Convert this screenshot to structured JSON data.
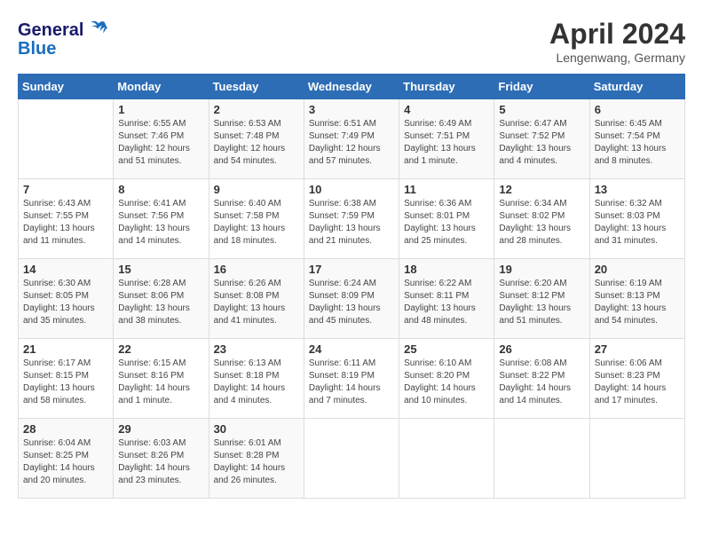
{
  "header": {
    "logo_general": "General",
    "logo_blue": "Blue",
    "month_year": "April 2024",
    "location": "Lengenwang, Germany"
  },
  "days_of_week": [
    "Sunday",
    "Monday",
    "Tuesday",
    "Wednesday",
    "Thursday",
    "Friday",
    "Saturday"
  ],
  "weeks": [
    [
      {
        "day": "",
        "sunrise": "",
        "sunset": "",
        "daylight": ""
      },
      {
        "day": "1",
        "sunrise": "6:55 AM",
        "sunset": "7:46 PM",
        "daylight": "12 hours and 51 minutes."
      },
      {
        "day": "2",
        "sunrise": "6:53 AM",
        "sunset": "7:48 PM",
        "daylight": "12 hours and 54 minutes."
      },
      {
        "day": "3",
        "sunrise": "6:51 AM",
        "sunset": "7:49 PM",
        "daylight": "12 hours and 57 minutes."
      },
      {
        "day": "4",
        "sunrise": "6:49 AM",
        "sunset": "7:51 PM",
        "daylight": "13 hours and 1 minute."
      },
      {
        "day": "5",
        "sunrise": "6:47 AM",
        "sunset": "7:52 PM",
        "daylight": "13 hours and 4 minutes."
      },
      {
        "day": "6",
        "sunrise": "6:45 AM",
        "sunset": "7:54 PM",
        "daylight": "13 hours and 8 minutes."
      }
    ],
    [
      {
        "day": "7",
        "sunrise": "6:43 AM",
        "sunset": "7:55 PM",
        "daylight": "13 hours and 11 minutes."
      },
      {
        "day": "8",
        "sunrise": "6:41 AM",
        "sunset": "7:56 PM",
        "daylight": "13 hours and 14 minutes."
      },
      {
        "day": "9",
        "sunrise": "6:40 AM",
        "sunset": "7:58 PM",
        "daylight": "13 hours and 18 minutes."
      },
      {
        "day": "10",
        "sunrise": "6:38 AM",
        "sunset": "7:59 PM",
        "daylight": "13 hours and 21 minutes."
      },
      {
        "day": "11",
        "sunrise": "6:36 AM",
        "sunset": "8:01 PM",
        "daylight": "13 hours and 25 minutes."
      },
      {
        "day": "12",
        "sunrise": "6:34 AM",
        "sunset": "8:02 PM",
        "daylight": "13 hours and 28 minutes."
      },
      {
        "day": "13",
        "sunrise": "6:32 AM",
        "sunset": "8:03 PM",
        "daylight": "13 hours and 31 minutes."
      }
    ],
    [
      {
        "day": "14",
        "sunrise": "6:30 AM",
        "sunset": "8:05 PM",
        "daylight": "13 hours and 35 minutes."
      },
      {
        "day": "15",
        "sunrise": "6:28 AM",
        "sunset": "8:06 PM",
        "daylight": "13 hours and 38 minutes."
      },
      {
        "day": "16",
        "sunrise": "6:26 AM",
        "sunset": "8:08 PM",
        "daylight": "13 hours and 41 minutes."
      },
      {
        "day": "17",
        "sunrise": "6:24 AM",
        "sunset": "8:09 PM",
        "daylight": "13 hours and 45 minutes."
      },
      {
        "day": "18",
        "sunrise": "6:22 AM",
        "sunset": "8:11 PM",
        "daylight": "13 hours and 48 minutes."
      },
      {
        "day": "19",
        "sunrise": "6:20 AM",
        "sunset": "8:12 PM",
        "daylight": "13 hours and 51 minutes."
      },
      {
        "day": "20",
        "sunrise": "6:19 AM",
        "sunset": "8:13 PM",
        "daylight": "13 hours and 54 minutes."
      }
    ],
    [
      {
        "day": "21",
        "sunrise": "6:17 AM",
        "sunset": "8:15 PM",
        "daylight": "13 hours and 58 minutes."
      },
      {
        "day": "22",
        "sunrise": "6:15 AM",
        "sunset": "8:16 PM",
        "daylight": "14 hours and 1 minute."
      },
      {
        "day": "23",
        "sunrise": "6:13 AM",
        "sunset": "8:18 PM",
        "daylight": "14 hours and 4 minutes."
      },
      {
        "day": "24",
        "sunrise": "6:11 AM",
        "sunset": "8:19 PM",
        "daylight": "14 hours and 7 minutes."
      },
      {
        "day": "25",
        "sunrise": "6:10 AM",
        "sunset": "8:20 PM",
        "daylight": "14 hours and 10 minutes."
      },
      {
        "day": "26",
        "sunrise": "6:08 AM",
        "sunset": "8:22 PM",
        "daylight": "14 hours and 14 minutes."
      },
      {
        "day": "27",
        "sunrise": "6:06 AM",
        "sunset": "8:23 PM",
        "daylight": "14 hours and 17 minutes."
      }
    ],
    [
      {
        "day": "28",
        "sunrise": "6:04 AM",
        "sunset": "8:25 PM",
        "daylight": "14 hours and 20 minutes."
      },
      {
        "day": "29",
        "sunrise": "6:03 AM",
        "sunset": "8:26 PM",
        "daylight": "14 hours and 23 minutes."
      },
      {
        "day": "30",
        "sunrise": "6:01 AM",
        "sunset": "8:28 PM",
        "daylight": "14 hours and 26 minutes."
      },
      {
        "day": "",
        "sunrise": "",
        "sunset": "",
        "daylight": ""
      },
      {
        "day": "",
        "sunrise": "",
        "sunset": "",
        "daylight": ""
      },
      {
        "day": "",
        "sunrise": "",
        "sunset": "",
        "daylight": ""
      },
      {
        "day": "",
        "sunrise": "",
        "sunset": "",
        "daylight": ""
      }
    ]
  ]
}
